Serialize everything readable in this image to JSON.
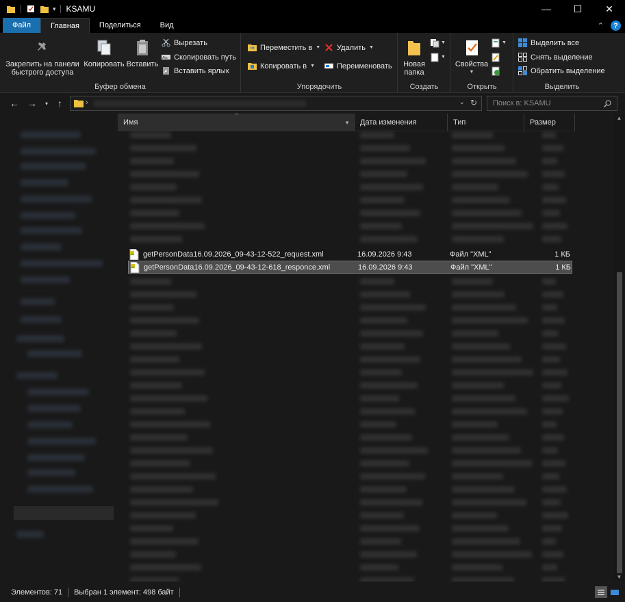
{
  "window": {
    "title": "KSAMU",
    "controls": {
      "minimize": "—",
      "maximize": "☐",
      "close": "✕"
    }
  },
  "ribbon_tabs": [
    {
      "label": "Файл"
    },
    {
      "label": "Главная"
    },
    {
      "label": "Поделиться"
    },
    {
      "label": "Вид"
    }
  ],
  "ribbon": {
    "clipboard": {
      "pin": "Закрепить на панели быстрого доступа",
      "pin_line1": "Закрепить на панели",
      "pin_line2": "быстрого доступа",
      "copy": "Копировать",
      "paste": "Вставить",
      "cut": "Вырезать",
      "copy_path": "Скопировать путь",
      "paste_shortcut": "Вставить ярлык",
      "label": "Буфер обмена"
    },
    "organize": {
      "move_to": "Переместить в",
      "copy_to": "Копировать в",
      "delete": "Удалить",
      "rename": "Переименовать",
      "label": "Упорядочить"
    },
    "new": {
      "new_folder_line1": "Новая",
      "new_folder_line2": "папка",
      "label": "Создать"
    },
    "open": {
      "properties": "Свойства",
      "label": "Открыть"
    },
    "select": {
      "select_all": "Выделить все",
      "select_none": "Снять выделение",
      "invert": "Обратить выделение",
      "label": "Выделить"
    }
  },
  "search": {
    "placeholder": "Поиск в: KSAMU"
  },
  "columns": {
    "name": "Имя",
    "date": "Дата изменения",
    "type": "Тип",
    "size": "Размер"
  },
  "files": [
    {
      "name": "getPersonData16.09.2026_09-43-12-522_request.xml",
      "date": "16.09.2026 9:43",
      "type": "Файл \"XML\"",
      "size": "1 КБ",
      "selected": false
    },
    {
      "name": "getPersonData16.09.2026_09-43-12-618_responce.xml",
      "date": "16.09.2026 9:43",
      "type": "Файл \"XML\"",
      "size": "1 КБ",
      "selected": true
    }
  ],
  "status": {
    "items": "Элементов: 71",
    "selection": "Выбран 1 элемент: 498 байт"
  },
  "colors": {
    "accent": "#1a6fae",
    "selection": "#4d4d4d",
    "background": "#191919"
  }
}
